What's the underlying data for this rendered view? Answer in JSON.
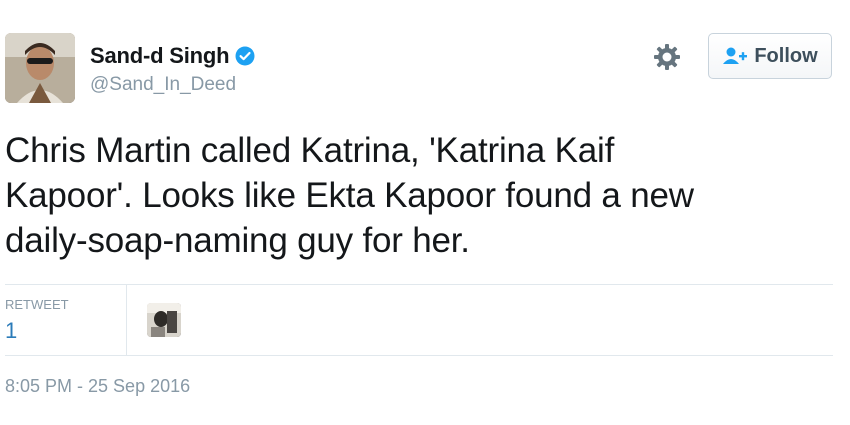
{
  "author": {
    "fullname": "Sand-d Singh",
    "username": "@Sand_In_Deed",
    "verified_icon": "verified-badge-icon",
    "verified_color": "#1da1f2"
  },
  "actions": {
    "settings_icon": "gear-icon",
    "follow_icon": "follow-user-icon",
    "follow_label": "Follow"
  },
  "tweet": {
    "text": "Chris Martin called Katrina, 'Katrina Kaif\nKapoor'. Looks like Ekta Kapoor found a new\ndaily-soap-naming guy for her."
  },
  "stats": {
    "retweet_label": "RETWEET",
    "retweet_count": "1"
  },
  "timestamp": "8:05 PM - 25 Sep 2016",
  "colors": {
    "link": "#2b7bb9",
    "muted": "#8899a6",
    "text": "#14171a",
    "border": "#e1e8ed"
  }
}
